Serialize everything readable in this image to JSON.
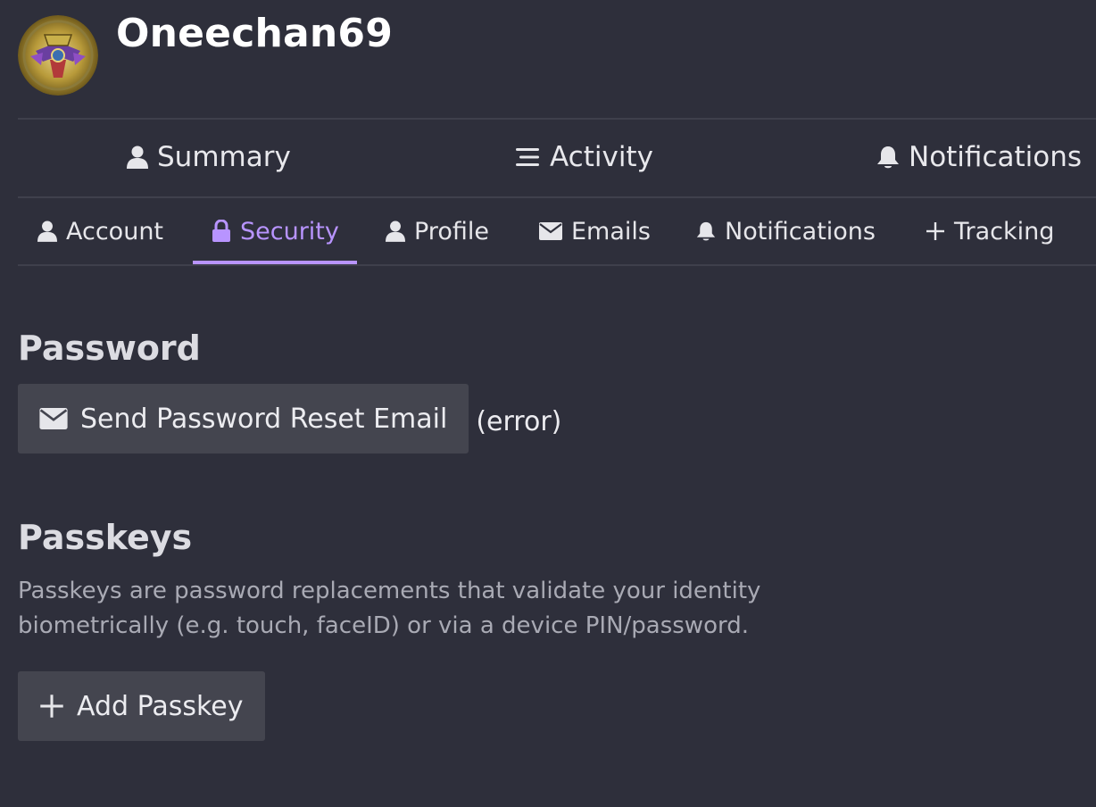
{
  "user": {
    "username": "Oneechan69"
  },
  "primary_nav": [
    {
      "label": "Summary",
      "icon": "user-icon"
    },
    {
      "label": "Activity",
      "icon": "list-icon"
    },
    {
      "label": "Notifications",
      "icon": "bell-icon"
    }
  ],
  "secondary_nav": [
    {
      "label": "Account",
      "icon": "user-icon"
    },
    {
      "label": "Security",
      "icon": "lock-icon",
      "active": true
    },
    {
      "label": "Profile",
      "icon": "user-icon"
    },
    {
      "label": "Emails",
      "icon": "envelope-icon"
    },
    {
      "label": "Notifications",
      "icon": "bell-icon"
    },
    {
      "label": "Tracking",
      "icon": "plus-icon"
    }
  ],
  "password": {
    "title": "Password",
    "reset_button_label": "Send Password Reset Email",
    "status": "(error)"
  },
  "passkeys": {
    "title": "Passkeys",
    "description_line1": "Passkeys are password replacements that validate your identity",
    "description_line2": "biometrically (e.g. touch, faceID) or via a device PIN/password.",
    "add_button_label": "Add Passkey"
  },
  "colors": {
    "background": "#2e2f3b",
    "accent": "#b894ff",
    "button": "#44454f"
  }
}
